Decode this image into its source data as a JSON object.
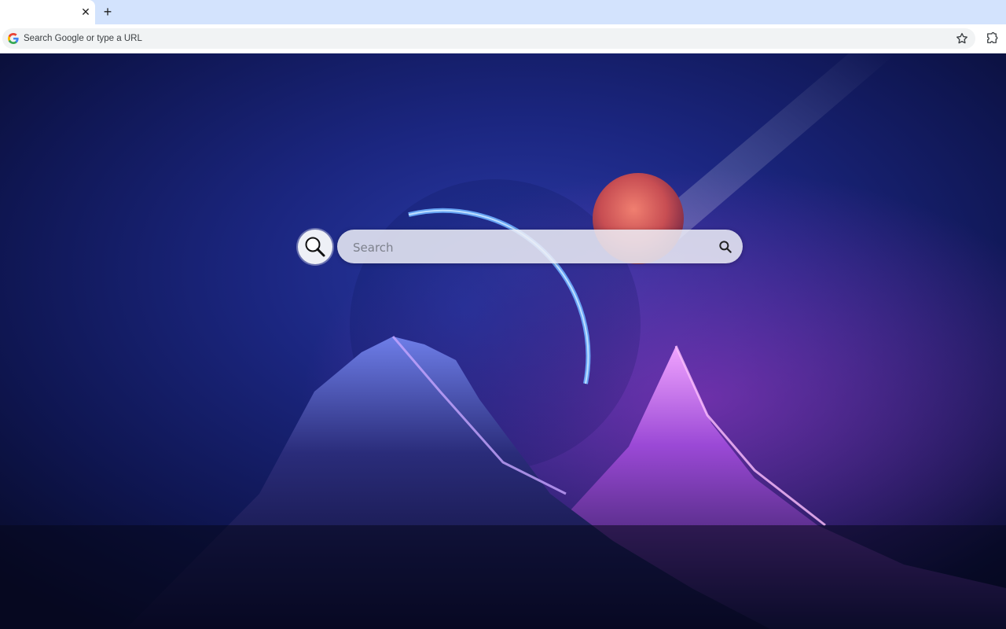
{
  "browser": {
    "tab": {
      "close_glyph": "✕"
    },
    "new_tab_glyph": "+",
    "omnibox": {
      "placeholder": "Search Google or type a URL"
    },
    "icons": {
      "omnibox_left": "google-g-icon",
      "bookmark": "star-icon",
      "extensions": "puzzle-icon"
    }
  },
  "newtab": {
    "search": {
      "placeholder": "Search",
      "submit_icon": "search-icon"
    },
    "logo_icon": "magnifier-icon",
    "background": "night sky with blue ringed planet, red moon and purple mountains"
  },
  "colors": {
    "tabstrip": "#d3e3fd",
    "toolbar": "#ffffff",
    "omnibox": "#f1f3f4",
    "sky_dark": "#0a0c2a",
    "planet_glow": "#3f8cff",
    "moon": "#d9625f",
    "mountain_glow": "#e07cff"
  }
}
